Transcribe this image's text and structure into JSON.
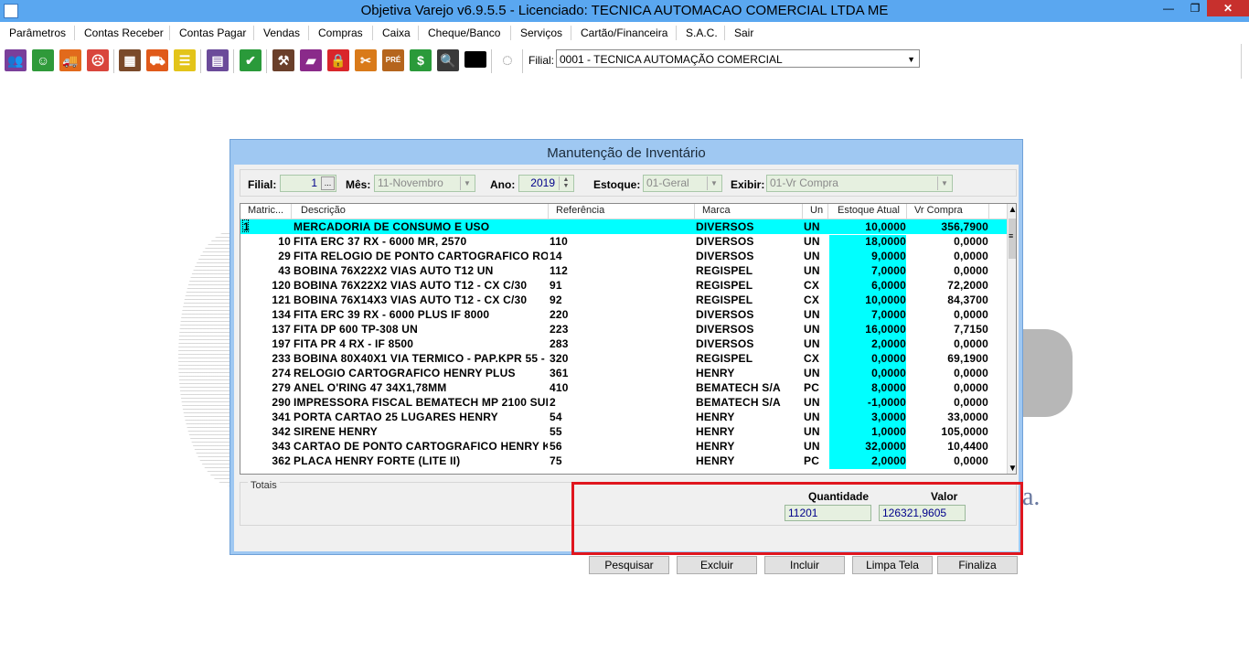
{
  "window": {
    "title": "Objetiva Varejo v6.9.5.5 - Licenciado: TECNICA AUTOMACAO COMERCIAL LTDA ME",
    "min_glyph": "—",
    "max_glyph": "❐",
    "close_glyph": "✕"
  },
  "menu": [
    "Parâmetros",
    "Contas Receber",
    "Contas Pagar",
    "Vendas",
    "Compras",
    "Caixa",
    "Cheque/Banco",
    "Serviços",
    "Cartão/Financeira",
    "S.A.C.",
    "Sair"
  ],
  "toolbar": {
    "icons": [
      {
        "name": "users-icon",
        "color": "#7a3f9a",
        "glyph": "👥"
      },
      {
        "name": "smile-icon",
        "color": "#2f9a3a",
        "glyph": "☺"
      },
      {
        "name": "truck-icon",
        "color": "#e26a1c",
        "glyph": "🚚"
      },
      {
        "name": "sad-face-icon",
        "color": "#d9453c",
        "glyph": "☹"
      },
      {
        "name": "boxes-icon",
        "color": "#7a4a2a",
        "glyph": "▦"
      },
      {
        "name": "basket-icon",
        "color": "#e05a1a",
        "glyph": "⛟"
      },
      {
        "name": "list-icon",
        "color": "#e3c41a",
        "glyph": "☰"
      },
      {
        "name": "calculator-icon",
        "color": "#6b4b9a",
        "glyph": "▤"
      },
      {
        "name": "fiscal-icon",
        "color": "#2a9a3a",
        "glyph": "✔"
      },
      {
        "name": "hammer-icon",
        "color": "#6a3f2a",
        "glyph": "⚒"
      },
      {
        "name": "book-icon",
        "color": "#8a2a8a",
        "glyph": "▰"
      },
      {
        "name": "lock-icon",
        "color": "#d9262a",
        "glyph": "🔒"
      },
      {
        "name": "tools-icon",
        "color": "#d97a1a",
        "glyph": "✂"
      },
      {
        "name": "pre-sale-icon",
        "color": "#b5651d",
        "glyph": "PRÉ"
      },
      {
        "name": "dollar-icon",
        "color": "#2a9a3a",
        "glyph": "$"
      },
      {
        "name": "search-icon",
        "color": "#3a3a3a",
        "glyph": "🔍"
      },
      {
        "name": "black-square-icon",
        "color": "#000000",
        "glyph": ""
      },
      {
        "name": "loading-circle-icon",
        "color": "#ffffff",
        "glyph": "◌"
      }
    ],
    "filial_label": "Filial:",
    "filial_value": "0001 - TECNICA AUTOMAÇÃO COMERCIAL"
  },
  "dialog": {
    "title": "Manutenção de Inventário",
    "filters": {
      "filial_label": "Filial:",
      "filial_value": "1",
      "mes_label": "Mês:",
      "mes_value": "11-Novembro",
      "ano_label": "Ano:",
      "ano_value": "2019",
      "estoque_label": "Estoque:",
      "estoque_value": "01-Geral",
      "exibir_label": "Exibir:",
      "exibir_value": "01-Vr Compra"
    },
    "columns": [
      "Matric...",
      "Descrição",
      "Referência",
      "Marca",
      "Un",
      "Estoque Atual",
      "Vr Compra"
    ],
    "rows": [
      {
        "mat": "1",
        "desc": "MERCADORIA DE CONSUMO E USO",
        "ref": "",
        "marca": "DIVERSOS",
        "un": "UN",
        "est": "10,0000",
        "vr": "356,7900"
      },
      {
        "mat": "10",
        "desc": "FITA ERC 37 RX - 6000 MR, 2570",
        "ref": "110",
        "marca": "DIVERSOS",
        "un": "UN",
        "est": "18,0000",
        "vr": "0,0000"
      },
      {
        "mat": "29",
        "desc": "FITA RELOGIO DE PONTO CARTOGRAFICO RO",
        "ref": "14",
        "marca": "DIVERSOS",
        "un": "UN",
        "est": "9,0000",
        "vr": "0,0000"
      },
      {
        "mat": "43",
        "desc": "BOBINA 76X22X2 VIAS AUTO T12 UN",
        "ref": "112",
        "marca": "REGISPEL",
        "un": "UN",
        "est": "7,0000",
        "vr": "0,0000"
      },
      {
        "mat": "120",
        "desc": "BOBINA 76X22X2 VIAS AUTO T12 - CX C/30",
        "ref": "91",
        "marca": "REGISPEL",
        "un": "CX",
        "est": "6,0000",
        "vr": "72,2000"
      },
      {
        "mat": "121",
        "desc": "BOBINA 76X14X3 VIAS AUTO T12 - CX C/30",
        "ref": "92",
        "marca": "REGISPEL",
        "un": "CX",
        "est": "10,0000",
        "vr": "84,3700"
      },
      {
        "mat": "134",
        "desc": "FITA ERC 39 RX - 6000 PLUS IF 8000",
        "ref": "220",
        "marca": "DIVERSOS",
        "un": "UN",
        "est": "7,0000",
        "vr": "0,0000"
      },
      {
        "mat": "137",
        "desc": "FITA DP 600 TP-308 UN",
        "ref": "223",
        "marca": "DIVERSOS",
        "un": "UN",
        "est": "16,0000",
        "vr": "7,7150"
      },
      {
        "mat": "197",
        "desc": "FITA PR 4 RX - IF 8500",
        "ref": "283",
        "marca": "DIVERSOS",
        "un": "UN",
        "est": "2,0000",
        "vr": "0,0000"
      },
      {
        "mat": "233",
        "desc": "BOBINA 80X40X1 VIA TERMICO - PAP.KPR 55 -",
        "ref": "320",
        "marca": "REGISPEL",
        "un": "CX",
        "est": "0,0000",
        "vr": "69,1900"
      },
      {
        "mat": "274",
        "desc": "RELOGIO CARTOGRAFICO HENRY PLUS",
        "ref": "361",
        "marca": "HENRY",
        "un": "UN",
        "est": "0,0000",
        "vr": "0,0000"
      },
      {
        "mat": "279",
        "desc": "ANEL O'RING 47 34X1,78MM",
        "ref": "410",
        "marca": "BEMATECH S/A",
        "un": "PC",
        "est": "8,0000",
        "vr": "0,0000"
      },
      {
        "mat": "290",
        "desc": "IMPRESSORA FISCAL BEMATECH MP 2100 SUI",
        "ref": "2",
        "marca": "BEMATECH S/A",
        "un": "UN",
        "est": "-1,0000",
        "vr": "0,0000"
      },
      {
        "mat": "341",
        "desc": "PORTA CARTAO 25 LUGARES HENRY",
        "ref": "54",
        "marca": "HENRY",
        "un": "UN",
        "est": "3,0000",
        "vr": "33,0000"
      },
      {
        "mat": "342",
        "desc": "SIRENE HENRY",
        "ref": "55",
        "marca": "HENRY",
        "un": "UN",
        "est": "1,0000",
        "vr": "105,0000"
      },
      {
        "mat": "343",
        "desc": "CARTAO DE PONTO CARTOGRAFICO HENRY K",
        "ref": "56",
        "marca": "HENRY",
        "un": "UN",
        "est": "32,0000",
        "vr": "10,4400"
      },
      {
        "mat": "362",
        "desc": "PLACA HENRY FORTE (LITE II)",
        "ref": "75",
        "marca": "HENRY",
        "un": "PC",
        "est": "2,0000",
        "vr": "0,0000"
      }
    ],
    "totals": {
      "label": "Totais",
      "quantidade_label": "Quantidade",
      "quantidade_value": "11201",
      "valor_label": "Valor",
      "valor_value": "126321,9605"
    },
    "buttons": {
      "pesquisar": "Pesquisar",
      "excluir": "Excluir",
      "incluir": "Incluir",
      "limpa_tela": "Limpa Tela",
      "finaliza": "Finaliza"
    }
  },
  "colors": {
    "titlebar": "#5aa7f0",
    "selected_row": "#00ffff",
    "highlight_frame": "#e0161e"
  }
}
